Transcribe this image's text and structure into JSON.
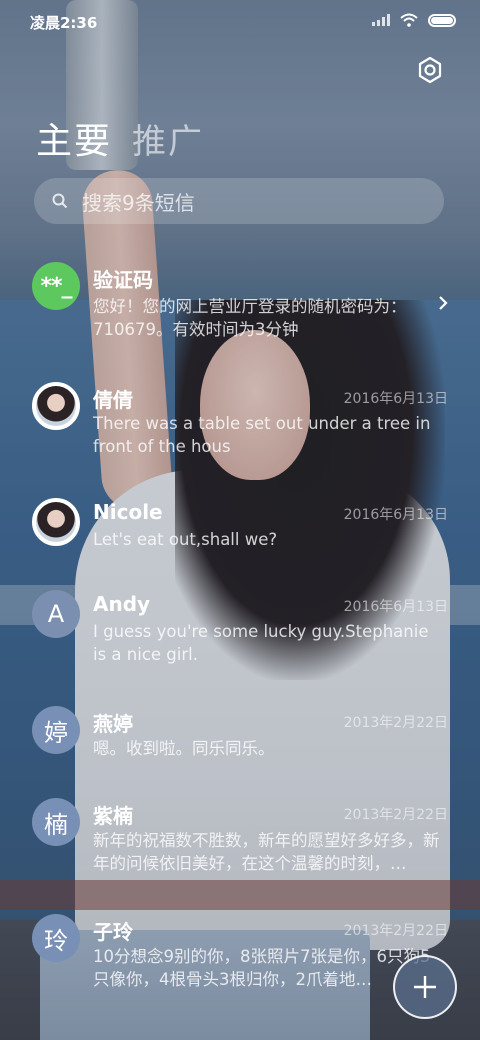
{
  "status": {
    "time": "凌晨2:36"
  },
  "tabs": {
    "main": "主要",
    "promo": "推广"
  },
  "search": {
    "placeholder": "搜索9条短信"
  },
  "messages": [
    {
      "name": "验证码",
      "avatar": "**_",
      "date": "",
      "preview": "您好！您的网上营业厅登录的随机密码为：710679。有效时间为3分钟"
    },
    {
      "name": "倩倩",
      "avatar": "",
      "date": "2016年6月13日",
      "preview": "There was a table set out under a tree in front of the hous"
    },
    {
      "name": "Nicole",
      "avatar": "",
      "date": "2016年6月13日",
      "preview": "Let's eat out,shall we?"
    },
    {
      "name": "Andy",
      "avatar": "A",
      "date": "2016年6月13日",
      "preview": "I guess you're some lucky guy.Stephanie is a nice girl."
    },
    {
      "name": "燕婷",
      "avatar": "婷",
      "date": "2013年2月22日",
      "preview": "嗯。收到啦。同乐同乐。"
    },
    {
      "name": "紫楠",
      "avatar": "楠",
      "date": "2013年2月22日",
      "preview": "新年的祝福数不胜数，新年的愿望好多好多，新年的问候依旧美好，在这个温馨的时刻，…"
    },
    {
      "name": "子玲",
      "avatar": "玲",
      "date": "2013年2月22日",
      "preview": "10分想念9别的你，8张照片7张是你，6只狗5只像你，4根骨头3根归你，2爪着地…"
    }
  ],
  "colors": {
    "verify_avatar": "#5cc85d",
    "letter_avatar": "#7b8fb1"
  },
  "icons": [
    "settings-icon",
    "search-icon",
    "chevron-right-icon",
    "plus-icon"
  ]
}
